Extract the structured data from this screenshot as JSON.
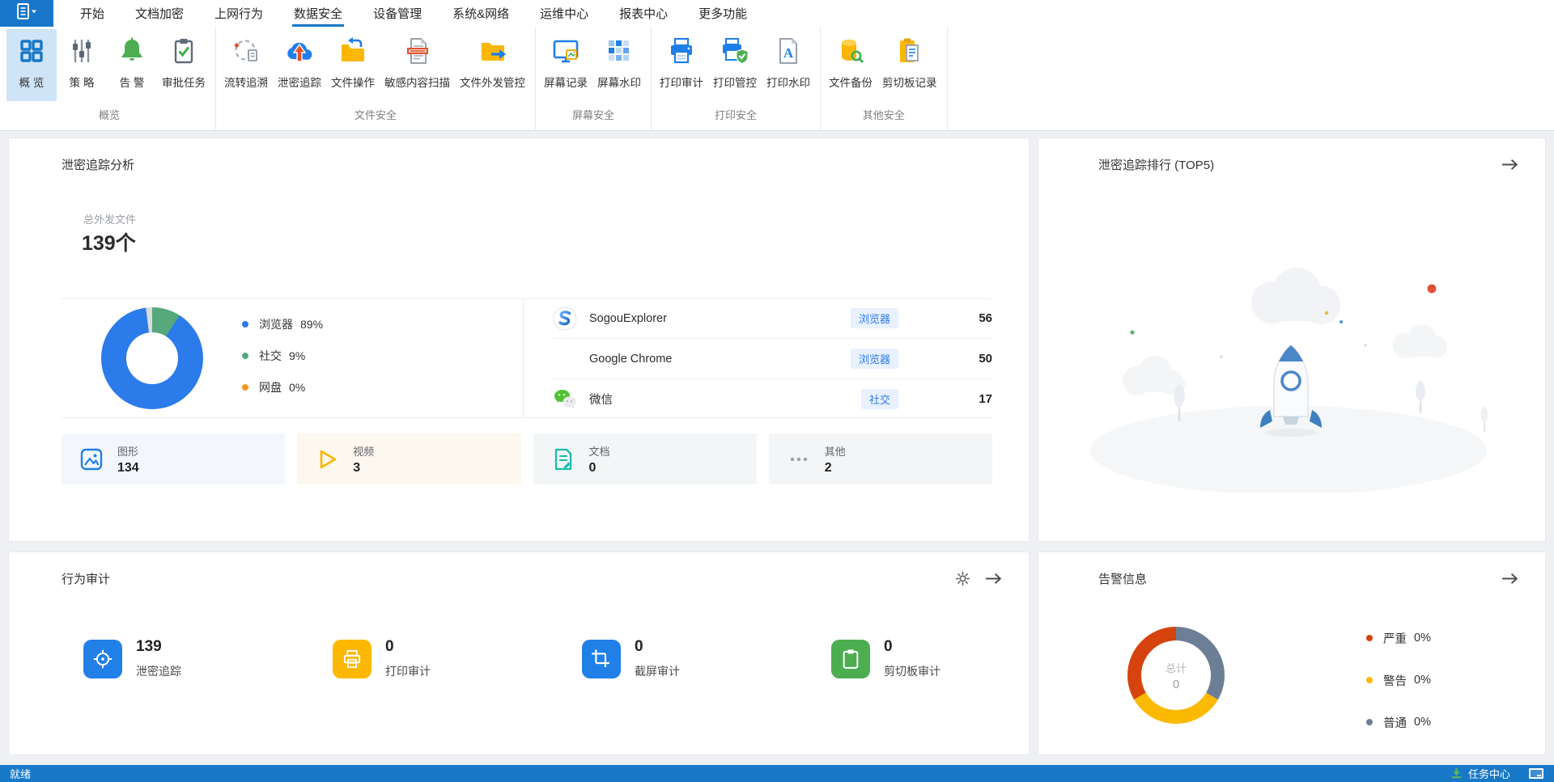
{
  "colors": {
    "accent_blue": "#1877c8",
    "ribbon_selected_bg": "#cfe4f7",
    "statusbar_bg": "#1779c8",
    "page_bg": "#eef0f3",
    "tag_bg": "#e8f1fd",
    "tag_text": "#2b7bea"
  },
  "menu": {
    "tabs": [
      {
        "label": "开始",
        "active": false
      },
      {
        "label": "文档加密",
        "active": false
      },
      {
        "label": "上网行为",
        "active": false
      },
      {
        "label": "数据安全",
        "active": true
      },
      {
        "label": "设备管理",
        "active": false
      },
      {
        "label": "系统&网络",
        "active": false
      },
      {
        "label": "运维中心",
        "active": false
      },
      {
        "label": "报表中心",
        "active": false
      },
      {
        "label": "更多功能",
        "active": false
      }
    ]
  },
  "ribbon": {
    "groups": [
      {
        "label": "概览",
        "items": [
          {
            "label": "概 览",
            "icon": "overview-grid-icon",
            "selected": true
          },
          {
            "label": "策 略",
            "icon": "policy-sliders-icon",
            "selected": false
          },
          {
            "label": "告 警",
            "icon": "alert-bell-icon",
            "selected": false
          },
          {
            "label": "审批任务",
            "icon": "approval-tasks-icon",
            "selected": false
          }
        ]
      },
      {
        "label": "文件安全",
        "items": [
          {
            "label": "流转追溯",
            "icon": "flow-trace-icon",
            "selected": false
          },
          {
            "label": "泄密追踪",
            "icon": "leak-trace-icon",
            "selected": false
          },
          {
            "label": "文件操作",
            "icon": "file-operation-icon",
            "selected": false
          },
          {
            "label": "敏感内容扫描",
            "icon": "sensitive-scan-icon",
            "selected": false
          },
          {
            "label": "文件外发管控",
            "icon": "file-outgoing-icon",
            "selected": false
          }
        ]
      },
      {
        "label": "屏幕安全",
        "items": [
          {
            "label": "屏幕记录",
            "icon": "screen-record-icon",
            "selected": false
          },
          {
            "label": "屏幕水印",
            "icon": "screen-watermark-icon",
            "selected": false
          }
        ]
      },
      {
        "label": "打印安全",
        "items": [
          {
            "label": "打印审计",
            "icon": "print-audit-icon",
            "selected": false
          },
          {
            "label": "打印管控",
            "icon": "print-control-icon",
            "selected": false
          },
          {
            "label": "打印水印",
            "icon": "print-watermark-icon",
            "selected": false
          }
        ]
      },
      {
        "label": "其他安全",
        "items": [
          {
            "label": "文件备份",
            "icon": "file-backup-icon",
            "selected": false
          },
          {
            "label": "剪切板记录",
            "icon": "clipboard-record-icon",
            "selected": false
          }
        ]
      }
    ]
  },
  "leak_analysis": {
    "title": "泄密追踪分析",
    "total_label": "总外发文件",
    "total_value": "139个",
    "apps": [
      {
        "name": "SogouExplorer",
        "tag": "浏览器",
        "value": "56",
        "icon": "sogou-browser-icon"
      },
      {
        "name": "Google Chrome",
        "tag": "浏览器",
        "value": "50",
        "icon": "chrome-browser-icon"
      },
      {
        "name": "微信",
        "tag": "社交",
        "value": "17",
        "icon": "wechat-icon"
      }
    ],
    "file_types": [
      {
        "label": "图形",
        "value": "134",
        "bg": "#f3f7fd",
        "icon": "image-file-icon"
      },
      {
        "label": "视频",
        "value": "3",
        "bg": "#fdf8ef",
        "icon": "video-file-icon"
      },
      {
        "label": "文档",
        "value": "0",
        "bg": "#f3f6f7",
        "icon": "doc-file-icon"
      },
      {
        "label": "其他",
        "value": "2",
        "bg": "#f4f5f6",
        "icon": "other-file-icon"
      }
    ]
  },
  "leak_rank": {
    "title": "泄密追踪排行 (TOP5)"
  },
  "behavior_audit": {
    "title": "行为审计",
    "stats": [
      {
        "value": "139",
        "label": "泄密追踪",
        "color": "#2080e8",
        "icon": "target-icon"
      },
      {
        "value": "0",
        "label": "打印审计",
        "color": "#fcb800",
        "icon": "printer-icon"
      },
      {
        "value": "0",
        "label": "截屏审计",
        "color": "#2080e8",
        "icon": "crop-icon"
      },
      {
        "value": "0",
        "label": "剪切板审计",
        "color": "#4cae50",
        "icon": "clipboard-icon"
      }
    ]
  },
  "alerts": {
    "title": "告警信息"
  },
  "statusbar": {
    "left": "就绪",
    "task_center": "任务中心"
  },
  "chart_data": [
    {
      "type": "pie",
      "subtype": "donut",
      "context": "泄密追踪分析外发渠道占比",
      "series": [
        {
          "name": "浏览器",
          "value": 89,
          "pct_label": "89%",
          "color": "#2b7bea"
        },
        {
          "name": "社交",
          "value": 9,
          "pct_label": "9%",
          "color": "#55a97c"
        },
        {
          "name": "网盘",
          "value": 0,
          "pct_label": "0%",
          "color": "#f59a23"
        }
      ],
      "visual_segments": [
        {
          "color": "#55a97c",
          "pct": 9
        },
        {
          "color": "#2b7bea",
          "pct": 89
        },
        {
          "color": "#d9dbdd",
          "pct": 2
        }
      ],
      "legend_position": "right"
    },
    {
      "type": "pie",
      "subtype": "donut",
      "context": "告警信息",
      "center_label": "总计",
      "center_value": "0",
      "series": [
        {
          "name": "严重",
          "value": 0,
          "pct_label": "0%",
          "color": "#d6430f"
        },
        {
          "name": "警告",
          "value": 0,
          "pct_label": "0%",
          "color": "#fbba00"
        },
        {
          "name": "普通",
          "value": 0,
          "pct_label": "0%",
          "color": "#6d7f96"
        }
      ],
      "visual_segments": [
        {
          "color": "#6d7f96",
          "pct": 33.34
        },
        {
          "color": "#fbba00",
          "pct": 33.33
        },
        {
          "color": "#d6430f",
          "pct": 33.33
        }
      ],
      "legend_position": "right"
    }
  ]
}
